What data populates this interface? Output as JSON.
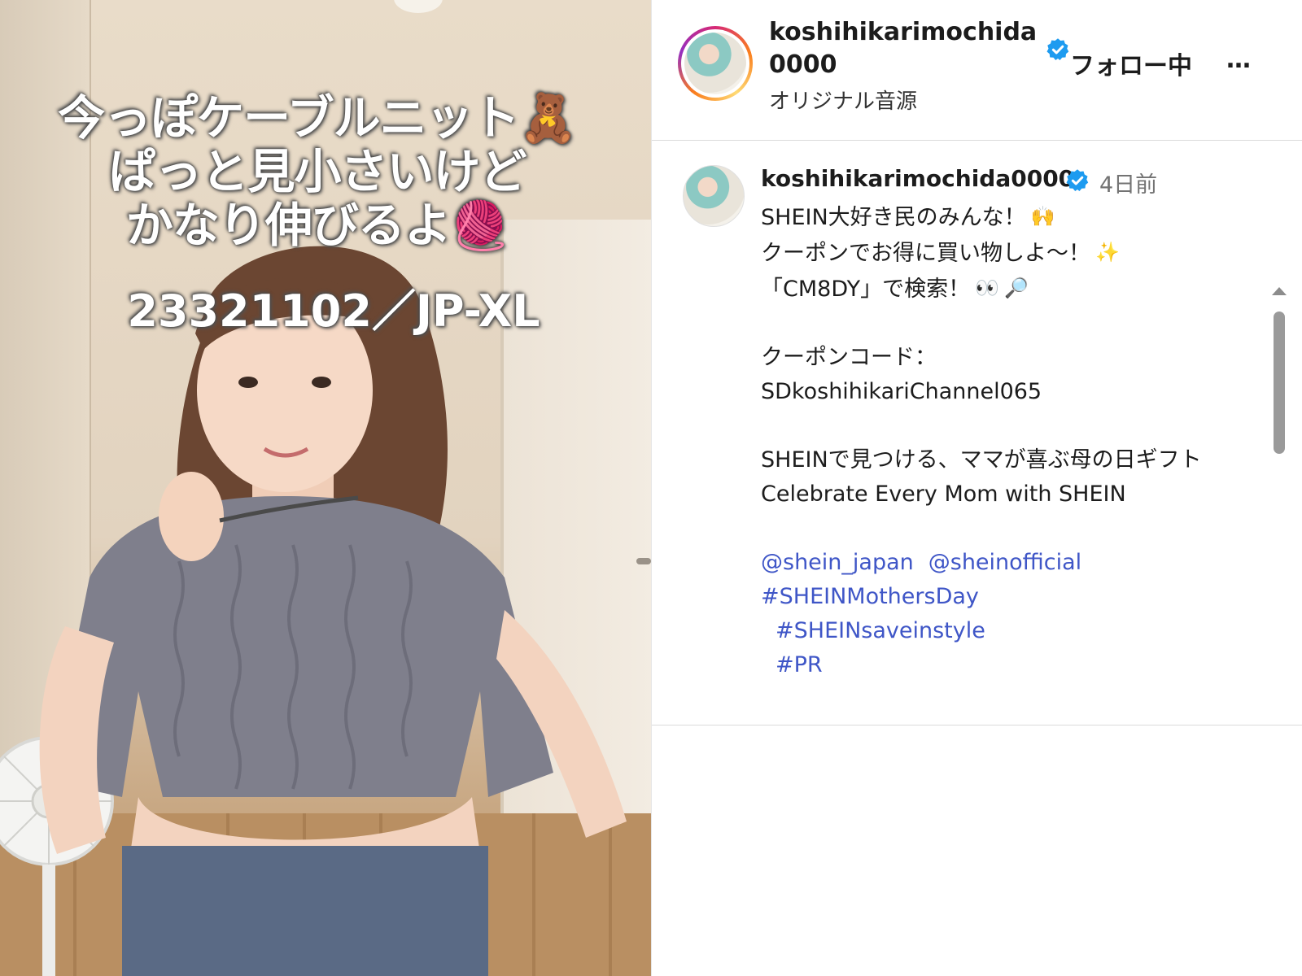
{
  "video": {
    "caption_lines": [
      "今っぽケーブルニット🧸",
      "ぱっと見小さいけど",
      "かなり伸びるよ🧶"
    ],
    "product_code": "23321102／JP-XL"
  },
  "post": {
    "header": {
      "username": "koshihikarimochida0000",
      "follow_label": "フォロー中",
      "more_label": "…",
      "audio": "オリジナル音源"
    },
    "comment": {
      "username": "koshihikarimochida0000",
      "time": "4日前",
      "lines": {
        "l1": "SHEIN大好き民のみんな！",
        "l1_emoji": "🙌",
        "l2": "クーポンでお得に買い物しよ〜！",
        "l2_emoji": "✨",
        "l3": "「CM8DY」で検索！",
        "l3_emoji1": "👀",
        "l3_emoji2": "🔎",
        "l4": "クーポンコード：",
        "l5": "SDkoshihikariChannel065",
        "l6": "SHEINで見つける、ママが喜ぶ母の日ギフト",
        "l7": "Celebrate Every Mom with SHEIN",
        "mention1": "@shein_japan",
        "mention2": "@sheinofficial",
        "tag1": "#SHEINMothersDay",
        "tag2": "#SHEINsaveinstyle",
        "tag3": "#PR"
      }
    },
    "colors": {
      "verified": "#1d9bf0",
      "link": "#3f56c7",
      "muted": "#737373"
    }
  }
}
